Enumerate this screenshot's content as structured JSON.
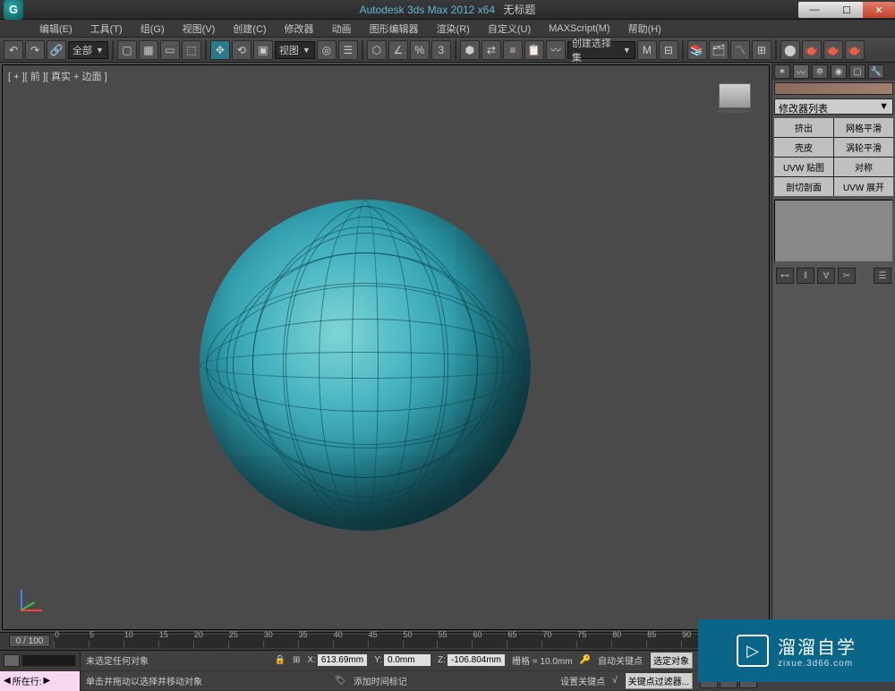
{
  "titlebar": {
    "app": "Autodesk 3ds Max 2012 x64",
    "document": "无标题"
  },
  "menus": [
    "编辑(E)",
    "工具(T)",
    "组(G)",
    "视图(V)",
    "创建(C)",
    "修改器",
    "动画",
    "图形编辑器",
    "渲染(R)",
    "自定义(U)",
    "MAXScript(M)",
    "帮助(H)"
  ],
  "toolbar": {
    "filter_all": "全部",
    "viewmode": "视图",
    "selection_set": "创建选择集"
  },
  "viewport": {
    "label": "[ + ][ 前 ][ 真实 + 边面 ]"
  },
  "modifier_panel": {
    "dropdown": "修改器列表",
    "buttons": [
      "挤出",
      "网格平滑",
      "壳皮",
      "涡轮平滑",
      "UVW 贴图",
      "对称",
      "剖切剖面",
      "UVW 展开"
    ]
  },
  "timeline": {
    "current": "0 / 100",
    "ticks": [
      "0",
      "5",
      "10",
      "15",
      "20",
      "25",
      "30",
      "35",
      "40",
      "45",
      "50",
      "55",
      "60",
      "65",
      "70",
      "75",
      "80",
      "85",
      "90"
    ]
  },
  "status": {
    "no_selection": "未选定任何对象",
    "hint": "单击并拖动以选择并移动对象",
    "x_label": "X:",
    "x_value": "613.69mm",
    "y_label": "Y:",
    "y_value": "0.0mm",
    "z_label": "Z:",
    "z_value": "-106.804mm",
    "grid": "栅格 = 10.0mm",
    "add_time_tag": "添加时间标记",
    "auto_key": "自动关键点",
    "sel_obj": "选定对象",
    "set_key": "设置关键点",
    "key_filter": "关键点过滤器...",
    "current_row": "所在行:"
  },
  "watermark": {
    "cn": "溜溜自学",
    "en": "zixue.3d66.com"
  }
}
